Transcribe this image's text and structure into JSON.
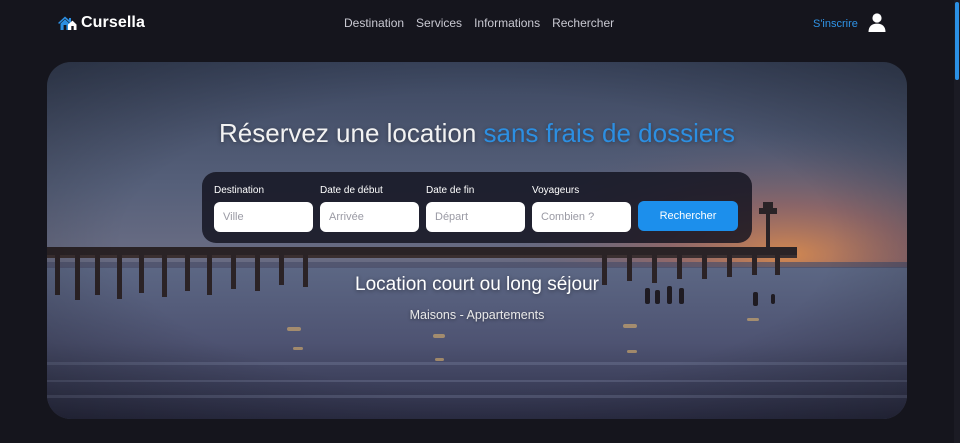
{
  "brand": {
    "name": "Cursella"
  },
  "nav": {
    "items": [
      {
        "label": "Destination"
      },
      {
        "label": "Services"
      },
      {
        "label": "Informations"
      },
      {
        "label": "Rechercher"
      }
    ]
  },
  "account": {
    "signup_label": "S'inscrire",
    "icon": "user-icon"
  },
  "hero": {
    "title_main": "Réservez une location",
    "title_accent": "sans frais de dossiers",
    "subtitle": "Location court ou long séjour",
    "caption": "Maisons - Appartements"
  },
  "search": {
    "fields": [
      {
        "label": "Destination",
        "placeholder": "Ville"
      },
      {
        "label": "Date de début",
        "placeholder": "Arrivée"
      },
      {
        "label": "Date de fin",
        "placeholder": "Départ"
      },
      {
        "label": "Voyageurs",
        "placeholder": "Combien ?"
      }
    ],
    "submit_label": "Rechercher"
  },
  "colors": {
    "accent": "#2c8fe2",
    "button": "#1c8fec",
    "background": "#15151d"
  }
}
